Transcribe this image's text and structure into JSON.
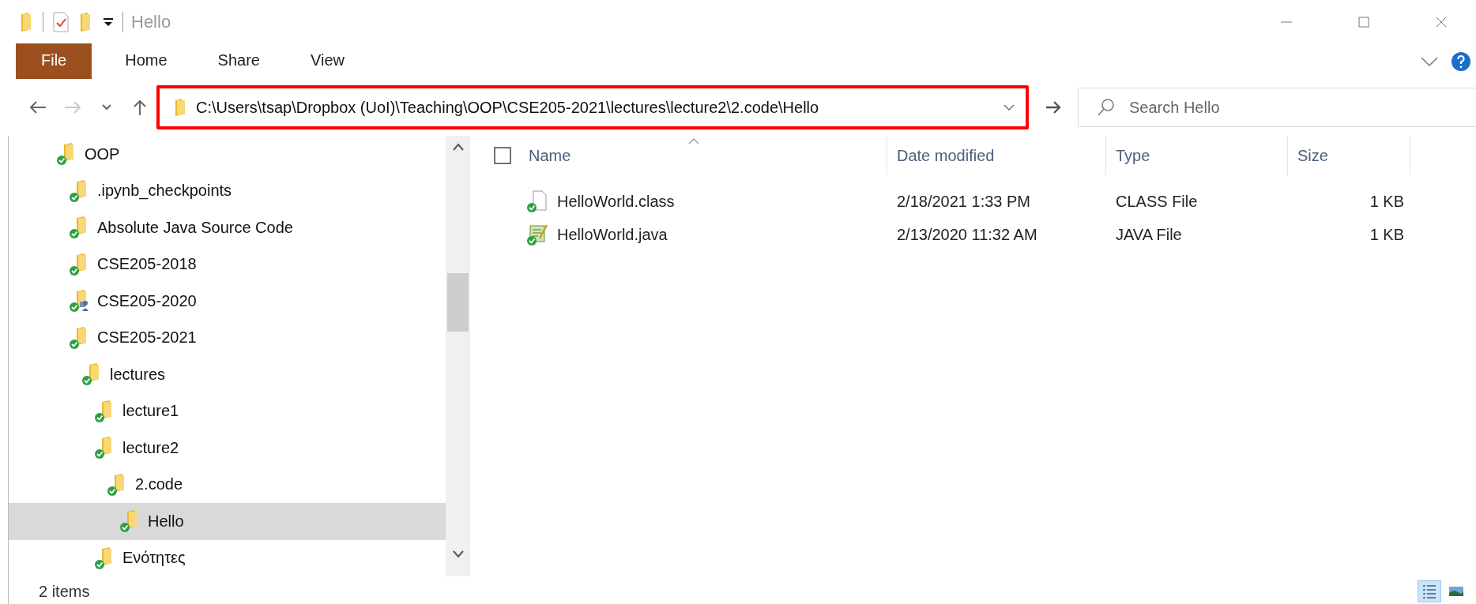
{
  "window": {
    "title": "Hello"
  },
  "ribbon_tabs": [
    {
      "label": "File",
      "kind": "file",
      "selected": false
    },
    {
      "label": "Home",
      "kind": "tab",
      "selected": false
    },
    {
      "label": "Share",
      "kind": "tab",
      "selected": false
    },
    {
      "label": "View",
      "kind": "tab",
      "selected": false
    }
  ],
  "nav_buttons": [
    {
      "kind": "back",
      "disabled": false
    },
    {
      "kind": "forward",
      "disabled": true
    },
    {
      "kind": "recent",
      "disabled": false
    },
    {
      "kind": "up",
      "disabled": false
    }
  ],
  "address_bar": {
    "path": "C:\\Users\\tsap\\Dropbox (UoI)\\Teaching\\OOP\\CSE205-2021\\lectures\\lecture2\\2.code\\Hello",
    "highlighted": true
  },
  "search": {
    "placeholder": "Search Hello"
  },
  "tree": {
    "items": [
      {
        "label": "OOP",
        "selected": false,
        "shared": false,
        "children": [
          {
            "label": ".ipynb_checkpoints",
            "selected": false,
            "shared": false
          },
          {
            "label": "Absolute Java Source Code",
            "selected": false,
            "shared": false
          },
          {
            "label": "CSE205-2018",
            "selected": false,
            "shared": false
          },
          {
            "label": "CSE205-2020",
            "selected": false,
            "shared": true
          },
          {
            "label": "CSE205-2021",
            "selected": false,
            "shared": false,
            "children": [
              {
                "label": "lectures",
                "selected": false,
                "shared": false,
                "children": [
                  {
                    "label": "lecture1",
                    "selected": false,
                    "shared": false
                  },
                  {
                    "label": "lecture2",
                    "selected": false,
                    "shared": false,
                    "children": [
                      {
                        "label": "2.code",
                        "selected": false,
                        "shared": false,
                        "children": [
                          {
                            "label": "Hello",
                            "selected": true,
                            "shared": false
                          }
                        ]
                      }
                    ]
                  },
                  {
                    "label": "Ενότητες",
                    "selected": false,
                    "shared": false
                  }
                ]
              }
            ]
          }
        ]
      }
    ]
  },
  "table": {
    "select_all": {
      "checked": false
    },
    "columns": [
      {
        "label": "Name",
        "sorted": true
      },
      {
        "label": "Date modified",
        "sorted": false
      },
      {
        "label": "Type",
        "sorted": false
      },
      {
        "label": "Size",
        "sorted": false
      }
    ],
    "rows": [
      {
        "kind": "class",
        "cells": [
          "HelloWorld.class",
          "2/18/2021 1:33 PM",
          "CLASS File",
          "1 KB"
        ]
      },
      {
        "kind": "java",
        "cells": [
          "HelloWorld.java",
          "2/13/2020 11:32 AM",
          "JAVA File",
          "1 KB"
        ]
      }
    ]
  },
  "status_bar": {
    "item_count": "2 items",
    "view_buttons": [
      {
        "kind": "details",
        "selected": true
      },
      {
        "kind": "tiles",
        "selected": false
      }
    ]
  }
}
